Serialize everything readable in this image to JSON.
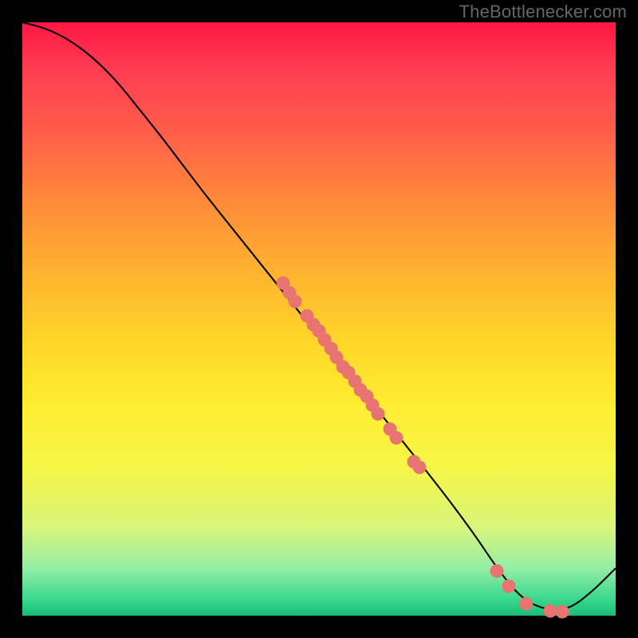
{
  "branding": {
    "watermark": "TheBottlenecker.com"
  },
  "chart_data": {
    "type": "line",
    "title": "",
    "xlabel": "",
    "ylabel": "",
    "xlim": [
      0,
      100
    ],
    "ylim": [
      0,
      100
    ],
    "curve": {
      "x": [
        0,
        4,
        8,
        12,
        16,
        20,
        24,
        30,
        38,
        46,
        54,
        62,
        70,
        76,
        80,
        84,
        88,
        92,
        96,
        100
      ],
      "y": [
        0,
        1,
        3,
        6,
        10,
        15,
        20,
        28,
        38,
        48,
        58,
        68,
        78,
        86,
        92,
        97,
        99,
        99,
        96,
        92
      ]
    },
    "valley_x": 88,
    "series": [
      {
        "name": "samples",
        "points": [
          {
            "x": 44,
            "y": 44
          },
          {
            "x": 45,
            "y": 45.5
          },
          {
            "x": 46,
            "y": 47
          },
          {
            "x": 48,
            "y": 49.5
          },
          {
            "x": 49,
            "y": 51
          },
          {
            "x": 50,
            "y": 52
          },
          {
            "x": 51,
            "y": 53.5
          },
          {
            "x": 52,
            "y": 55
          },
          {
            "x": 53,
            "y": 56.5
          },
          {
            "x": 54,
            "y": 58
          },
          {
            "x": 55,
            "y": 59
          },
          {
            "x": 56,
            "y": 60.5
          },
          {
            "x": 57,
            "y": 62
          },
          {
            "x": 58,
            "y": 63
          },
          {
            "x": 59,
            "y": 64.5
          },
          {
            "x": 60,
            "y": 66
          },
          {
            "x": 62,
            "y": 68.5
          },
          {
            "x": 63,
            "y": 70
          },
          {
            "x": 66,
            "y": 74
          },
          {
            "x": 67,
            "y": 75
          },
          {
            "x": 80,
            "y": 92.5
          },
          {
            "x": 82,
            "y": 95
          },
          {
            "x": 85,
            "y": 98
          },
          {
            "x": 89,
            "y": 99.2
          },
          {
            "x": 91,
            "y": 99.3
          }
        ]
      }
    ]
  }
}
